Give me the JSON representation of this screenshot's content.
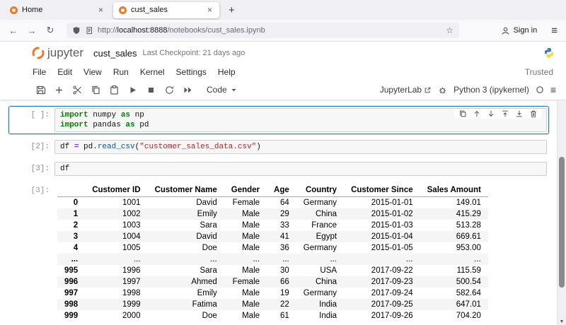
{
  "browser": {
    "tabs": [
      {
        "label": "Home"
      },
      {
        "label": "cust_sales"
      }
    ],
    "close_tab_glyph": "×",
    "new_tab_glyph": "+",
    "back_glyph": "←",
    "forward_glyph": "→",
    "reload_glyph": "↻",
    "url": {
      "protocol": "http://",
      "host": "localhost:8888",
      "path": "/notebooks/cust_sales.ipynb"
    },
    "bookmark_glyph": "☆",
    "sign_in_label": "Sign in",
    "menu_glyph": "≡"
  },
  "header": {
    "logo_text": "jupyter",
    "title": "cust_sales",
    "checkpoint": "Last Checkpoint: 21 days ago"
  },
  "menubar": {
    "items": [
      "File",
      "Edit",
      "View",
      "Run",
      "Kernel",
      "Settings",
      "Help"
    ],
    "trusted_label": "Trusted"
  },
  "toolbar": {
    "cell_type_label": "Code",
    "jupyterlab_label": "JupyterLab",
    "kernel_label": "Python 3 (ipykernel)",
    "kernel_menu_glyph": "≡"
  },
  "colors": {
    "jupyter_orange": "#F37626",
    "selected_cell_border": "#2479C2",
    "keyword": "#008000",
    "string": "#BA2121",
    "function": "#0055AA",
    "table_stripe": "#F5F5F5"
  },
  "notebook": {
    "cells": [
      {
        "prompt": "[ ]:",
        "lines": [
          [
            [
              "kw",
              "import"
            ],
            [
              "pl",
              " numpy "
            ],
            [
              "kw",
              "as"
            ],
            [
              "pl",
              " np"
            ]
          ],
          [
            [
              "kw",
              "import"
            ],
            [
              "pl",
              " pandas "
            ],
            [
              "kw",
              "as"
            ],
            [
              "pl",
              " pd"
            ]
          ]
        ]
      },
      {
        "prompt": "[2]:",
        "lines": [
          [
            [
              "pl",
              "df "
            ],
            [
              "op",
              "="
            ],
            [
              "pl",
              " pd."
            ],
            [
              "fn",
              "read_csv"
            ],
            [
              "pl",
              "("
            ],
            [
              "st",
              "\"customer_sales_data.csv\""
            ],
            [
              "pl",
              ")"
            ]
          ]
        ]
      },
      {
        "prompt": "[3]:",
        "lines": [
          [
            [
              "pl",
              "df"
            ]
          ]
        ]
      }
    ],
    "output": {
      "prompt": "[3]:",
      "table": {
        "columns": [
          "",
          "Customer ID",
          "Customer Name",
          "Gender",
          "Age",
          "Country",
          "Customer Since",
          "Sales Amount"
        ],
        "rows": [
          [
            "0",
            "1001",
            "David",
            "Female",
            "64",
            "Germany",
            "2015-01-01",
            "149.01"
          ],
          [
            "1",
            "1002",
            "Emily",
            "Male",
            "29",
            "China",
            "2015-01-02",
            "415.29"
          ],
          [
            "2",
            "1003",
            "Sara",
            "Male",
            "33",
            "France",
            "2015-01-03",
            "513.28"
          ],
          [
            "3",
            "1004",
            "David",
            "Male",
            "41",
            "Egypt",
            "2015-01-04",
            "669.61"
          ],
          [
            "4",
            "1005",
            "Doe",
            "Male",
            "36",
            "Germany",
            "2015-01-05",
            "953.00"
          ],
          [
            "...",
            "...",
            "...",
            "...",
            "...",
            "...",
            "...",
            "..."
          ],
          [
            "995",
            "1996",
            "Sara",
            "Male",
            "30",
            "USA",
            "2017-09-22",
            "115.59"
          ],
          [
            "996",
            "1997",
            "Ahmed",
            "Female",
            "66",
            "China",
            "2017-09-23",
            "500.54"
          ],
          [
            "997",
            "1998",
            "Emily",
            "Male",
            "19",
            "Germany",
            "2017-09-24",
            "582.64"
          ],
          [
            "998",
            "1999",
            "Fatima",
            "Male",
            "22",
            "India",
            "2017-09-25",
            "647.01"
          ],
          [
            "999",
            "2000",
            "Doe",
            "Male",
            "61",
            "India",
            "2017-09-26",
            "704.20"
          ]
        ]
      }
    }
  }
}
